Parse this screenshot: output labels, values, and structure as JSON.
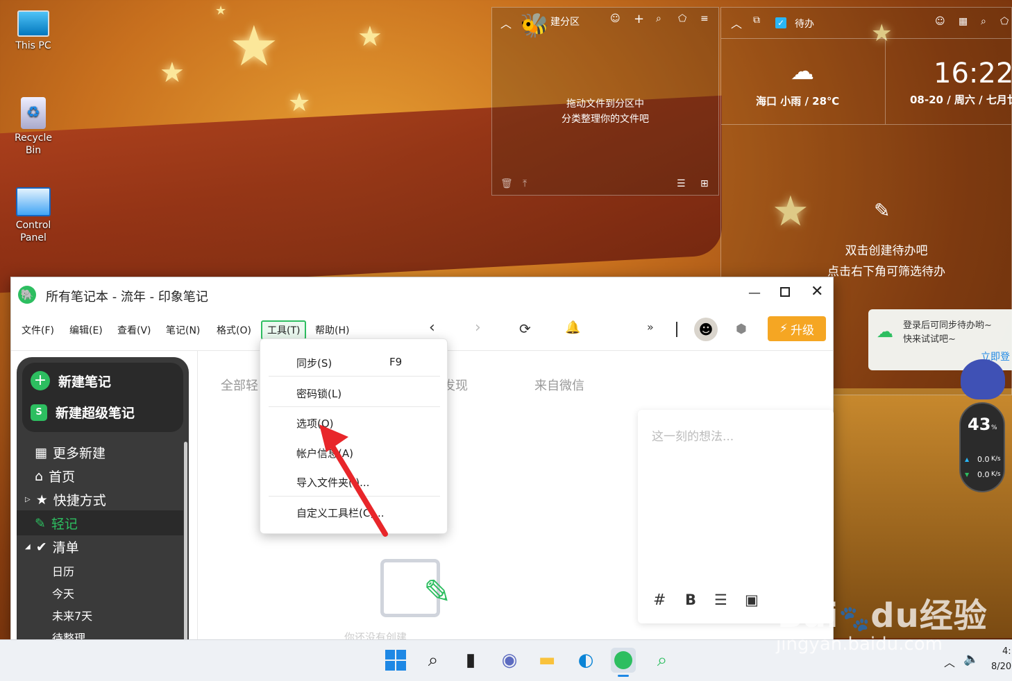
{
  "desktop": {
    "icons": [
      {
        "label": "This PC",
        "icon": "monitor-icon"
      },
      {
        "label": "Recycle Bin",
        "icon": "recycle-bin-icon"
      },
      {
        "label": "Control Panel",
        "icon": "control-panel-icon"
      }
    ],
    "partition_widget": {
      "title": "建分区",
      "hint1": "拖动文件到分区中",
      "hint2": "分类整理你的文件吧"
    },
    "todo_widget": {
      "title": "待办",
      "time": "16:22",
      "date": "08-20 / 周六 / 七月廿",
      "weather": "海口 小雨 / 28℃",
      "hint1": "双击创建待办吧",
      "hint2": "点击右下角可筛选待办"
    },
    "login_popup": {
      "text1": "登录后可同步待办哟~",
      "text2": "快来试试吧~",
      "link": "立即登"
    },
    "netmeter": {
      "percent": "43",
      "percent_unit": "%",
      "up": "0.0",
      "down": "0.0",
      "unit": "K/s"
    },
    "watermark": {
      "line1": "Bai",
      "line2": "du",
      "line3": "经验",
      "url": "jingyan.baidu.com"
    }
  },
  "window": {
    "title": "所有笔记本 - 流年 - 印象笔记",
    "menu": [
      "文件(F)",
      "编辑(E)",
      "查看(V)",
      "笔记(N)",
      "格式(O)",
      "工具(T)",
      "帮助(H)"
    ],
    "upgrade": "升级",
    "sidebar": {
      "new_note": "新建笔记",
      "new_super_note": "新建超级笔记",
      "items": [
        "更多新建",
        "首页",
        "快捷方式",
        "轻记",
        "清单"
      ],
      "subitems": [
        "日历",
        "今天",
        "未来7天",
        "待整理"
      ]
    },
    "tabs": [
      "全部轻",
      "发现",
      "来自微信"
    ],
    "quick_input": {
      "placeholder": "这一刻的想法..."
    },
    "empty_hint": "你还没有创建",
    "dropdown": [
      {
        "label": "同步(S)",
        "shortcut": "F9"
      },
      {
        "label": "密码锁(L)",
        "shortcut": ""
      },
      {
        "label": "选项(O)",
        "shortcut": ""
      },
      {
        "label": "帐户信息(A)",
        "shortcut": ""
      },
      {
        "label": "导入文件夹(I)...",
        "shortcut": ""
      },
      {
        "label": "自定义工具栏(C)...",
        "shortcut": ""
      }
    ]
  },
  "taskbar": {
    "time": "4:",
    "date": "8/20"
  },
  "colors": {
    "accent_green": "#2dbe60",
    "upgrade": "#f5a623",
    "arrow": "#e8262a"
  }
}
